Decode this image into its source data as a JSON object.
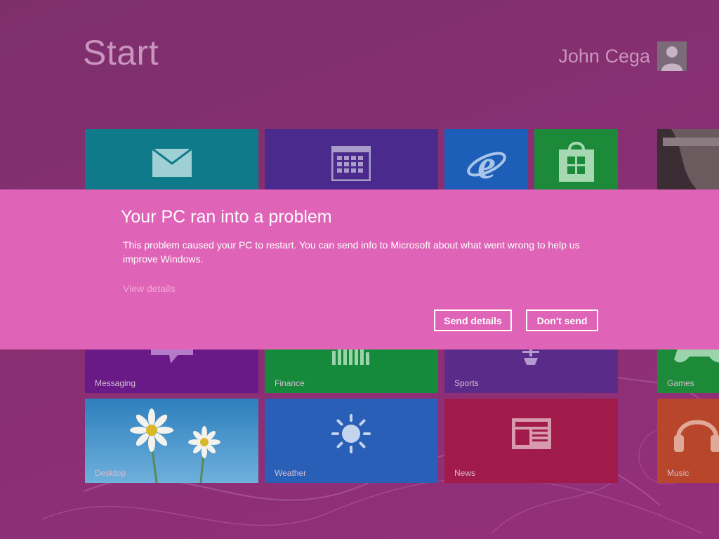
{
  "screen": {
    "title": "Start",
    "user": {
      "name": "John Cega",
      "avatar_icon": "user-silhouette-icon"
    }
  },
  "tiles": {
    "mail": {
      "label": "",
      "icon": "mail-icon",
      "color": "#0e7a8a"
    },
    "calendar": {
      "label": "",
      "icon": "calendar-icon",
      "color": "#4a2a8c"
    },
    "internet_explorer": {
      "label": "",
      "icon": "internet-explorer-icon",
      "color": "#1d5fb8"
    },
    "store": {
      "label": "",
      "icon": "store-icon",
      "color": "#1d8a3a"
    },
    "photos": {
      "label": "",
      "icon": "photo-thumbnail",
      "color": "#4a3a40"
    },
    "messaging": {
      "label": "Messaging",
      "icon": "speech-bubble-icon",
      "color": "#6a1a86"
    },
    "finance": {
      "label": "Finance",
      "icon": "bar-chart-icon",
      "color": "#148a3a"
    },
    "sports": {
      "label": "Sports",
      "icon": "trophy-icon",
      "color": "#5b2b8a"
    },
    "games": {
      "label": "Games",
      "icon": "game-controller-icon",
      "color": "#1d8a3a"
    },
    "desktop": {
      "label": "Desktop",
      "icon": "daisy-flowers-image",
      "color": "#3a8ab8"
    },
    "weather": {
      "label": "Weather",
      "icon": "sun-icon",
      "color": "#2a5fb8"
    },
    "news": {
      "label": "News",
      "icon": "newspaper-icon",
      "color": "#a01a4a"
    },
    "music": {
      "label": "Music",
      "icon": "headphones-icon",
      "color": "#b8462a"
    }
  },
  "dialog": {
    "title": "Your PC ran into a problem",
    "message": "This problem caused your PC to restart. You can send info to Microsoft about what went wrong to help us improve Windows.",
    "view_details": "View details",
    "send_button": "Send details",
    "dont_send_button": "Don't send",
    "color": "#df64b7"
  }
}
